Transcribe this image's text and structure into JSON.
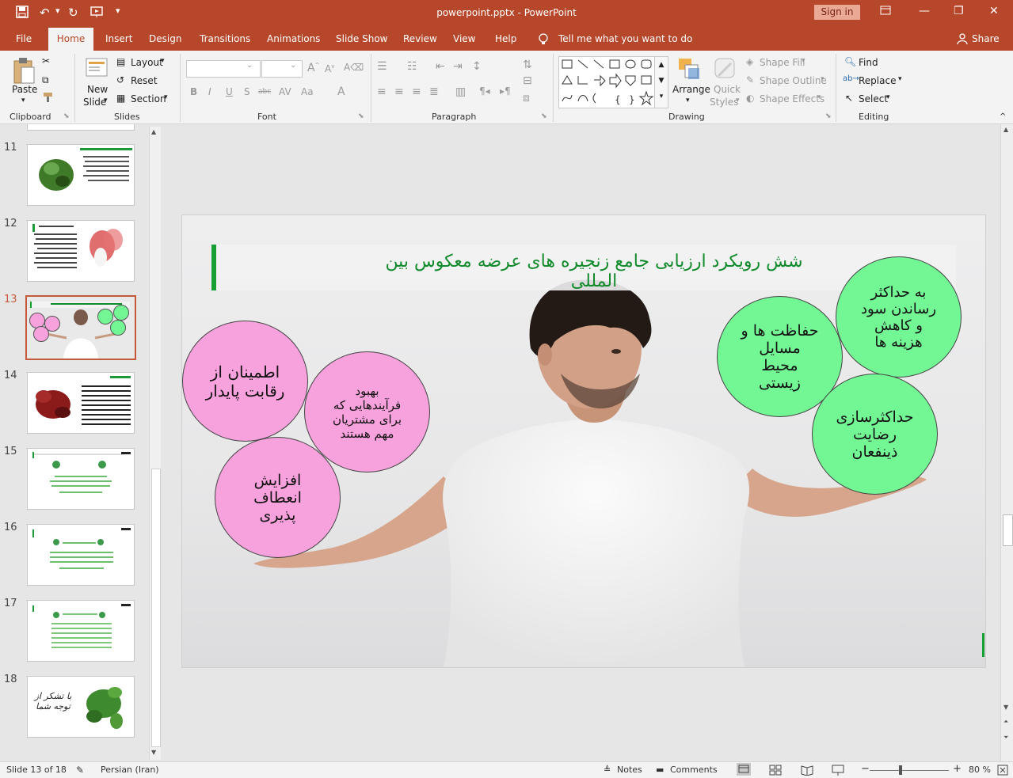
{
  "window": {
    "title": "powerpoint.pptx  -  PowerPoint",
    "sign_in": "Sign in"
  },
  "tabs": [
    "File",
    "Home",
    "Insert",
    "Design",
    "Transitions",
    "Animations",
    "Slide Show",
    "Review",
    "View",
    "Help"
  ],
  "active_tab": "Home",
  "tell_me": "Tell me what you want to do",
  "share": "Share",
  "ribbon": {
    "clipboard": {
      "label": "Clipboard",
      "paste": "Paste"
    },
    "slides": {
      "label": "Slides",
      "new_slide_1": "New",
      "new_slide_2": "Slide",
      "layout": "Layout",
      "reset": "Reset",
      "section": "Section"
    },
    "font": {
      "label": "Font"
    },
    "paragraph": {
      "label": "Paragraph"
    },
    "drawing": {
      "label": "Drawing",
      "arrange": "Arrange",
      "quick_styles_1": "Quick",
      "quick_styles_2": "Styles",
      "shape_fill": "Shape Fill",
      "shape_outline": "Shape Outline",
      "shape_effects": "Shape Effects"
    },
    "editing": {
      "label": "Editing",
      "find": "Find",
      "replace": "Replace",
      "select": "Select"
    }
  },
  "thumbnails": [
    {
      "num": "11",
      "selected": false
    },
    {
      "num": "12",
      "selected": false
    },
    {
      "num": "13",
      "selected": true
    },
    {
      "num": "14",
      "selected": false
    },
    {
      "num": "15",
      "selected": false
    },
    {
      "num": "16",
      "selected": false
    },
    {
      "num": "17",
      "selected": false
    },
    {
      "num": "18",
      "selected": false
    }
  ],
  "slide": {
    "title": "شش رویکرد ارزیابی جامع زنجیره های عرضه معکوس بین المللی",
    "bubbles": {
      "pink_1": "اطمینان از\nرقابت پایدار",
      "pink_2": "بهبود\nفرآیندهایی که\nبرای مشتریان\nمهم هستند",
      "pink_3": "افزایش\nانعطاف\nپذیری",
      "green_1": "حفاظت ها و\nمسایل\nمحیط\nزیستی",
      "green_2": "به حداکثر\nرساندن سود\nو کاهش\nهزینه ها",
      "green_3": "حداکثرسازی\nرضایت\nذینفعان"
    },
    "colors": {
      "pink": "#f7a1dd",
      "green": "#73f794",
      "title_green": "#118a2b",
      "accent_bar": "#16a034"
    }
  },
  "thumb18_text": "با تشکر از توجه شما",
  "status": {
    "slide_info": "Slide 13 of 18",
    "language": "Persian (Iran)",
    "notes": "Notes",
    "comments": "Comments",
    "zoom": "80 %"
  }
}
